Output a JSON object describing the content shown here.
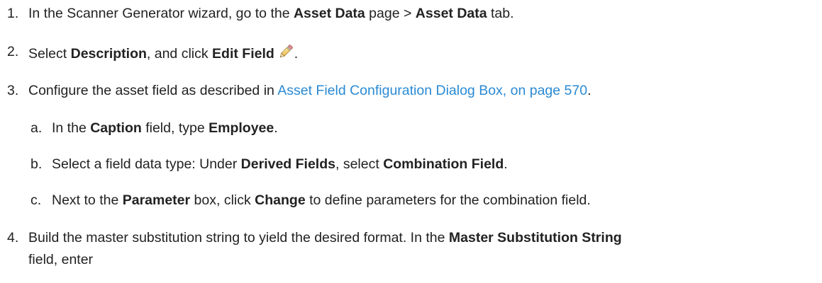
{
  "steps": [
    {
      "num": "1.",
      "t1": "In the Scanner Generator wizard, go to the ",
      "b1": "Asset Data",
      "t2": " page > ",
      "b2": "Asset Data",
      "t3": " tab."
    },
    {
      "num": "2.",
      "t1": "Select ",
      "b1": "Description",
      "t2": ", and click ",
      "b2": "Edit Field",
      "icon": "pencil-edit-icon",
      "t3": "."
    },
    {
      "num": "3.",
      "t1": "Configure the asset field as described in ",
      "link": "Asset Field Configuration Dialog Box, on page 570",
      "t2": "."
    },
    {
      "num": "4.",
      "t1": "Build the master substitution string to yield the desired format. In the ",
      "b1": "Master Substitution String",
      "t2": "field, enter"
    }
  ],
  "substeps": [
    {
      "num": "a.",
      "t1": "In the ",
      "b1": "Caption",
      "t2": " field, type ",
      "b2": "Employee",
      "t3": "."
    },
    {
      "num": "b.",
      "t1": "Select a field data type: Under ",
      "b1": "Derived Fields",
      "t2": ", select ",
      "b2": "Combination Field",
      "t3": "."
    },
    {
      "num": "c.",
      "t1": "Next to the ",
      "b1": "Parameter",
      "t2": " box, click ",
      "b2": "Change",
      "t3": " to define parameters for the combination field."
    }
  ],
  "colors": {
    "text": "#222222",
    "link": "#2a8ad4"
  }
}
